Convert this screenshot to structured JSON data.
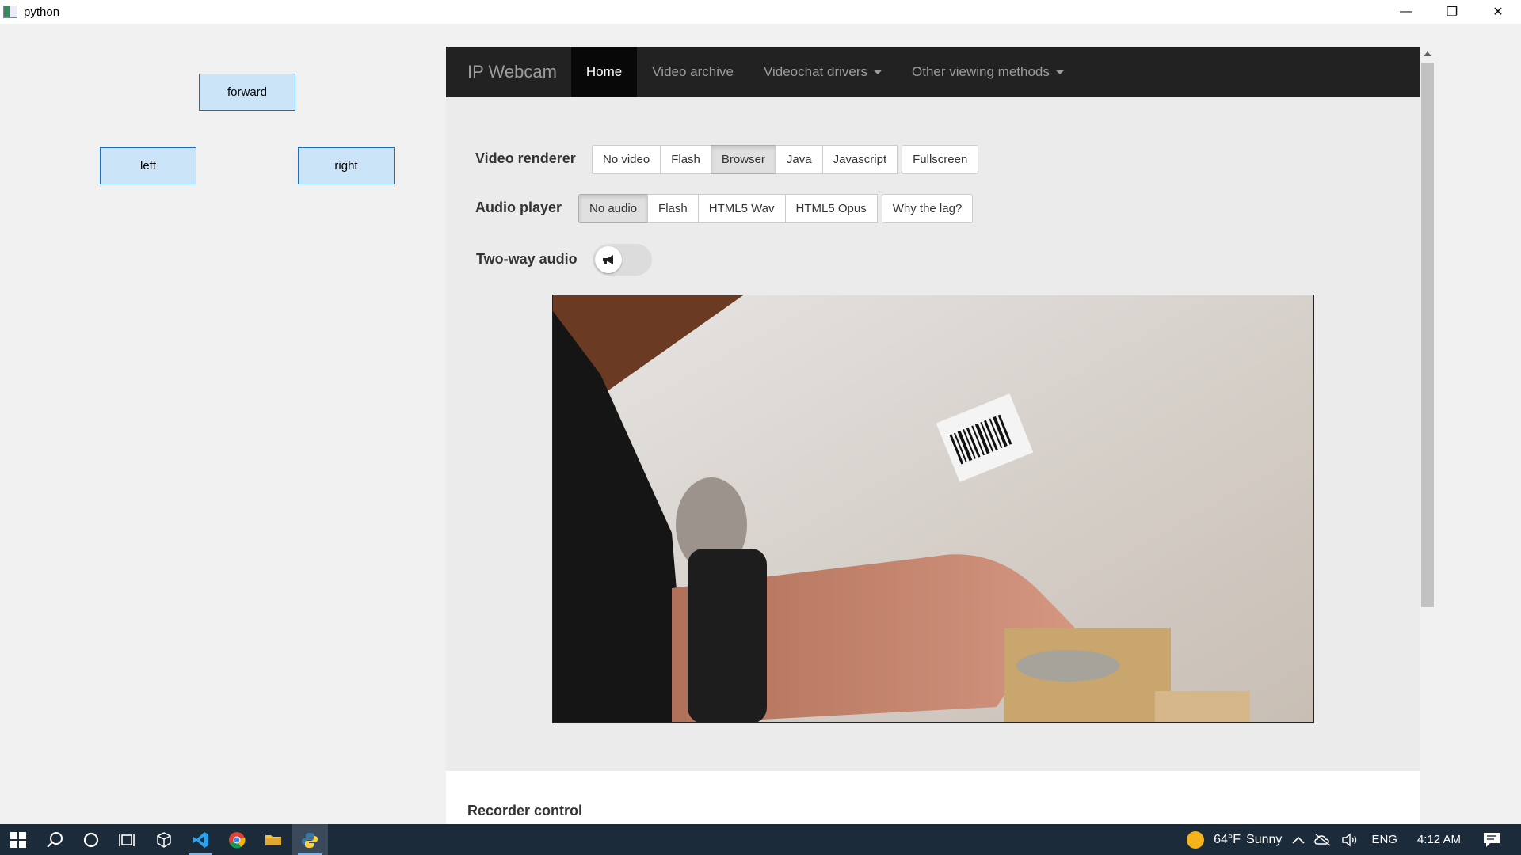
{
  "window": {
    "title": "python",
    "minimize_glyph": "—",
    "restore_glyph": "❐",
    "close_glyph": "✕"
  },
  "controls": {
    "forward": "forward",
    "left": "left",
    "right": "right"
  },
  "webcam": {
    "brand": "IP Webcam",
    "nav": {
      "home": "Home",
      "video_archive": "Video archive",
      "videochat_drivers": "Videochat drivers",
      "other_viewing_methods": "Other viewing methods"
    },
    "video_renderer": {
      "label": "Video renderer",
      "options": [
        "No video",
        "Flash",
        "Browser",
        "Java",
        "Javascript"
      ],
      "selected": "Browser",
      "fullscreen": "Fullscreen"
    },
    "audio_player": {
      "label": "Audio player",
      "options": [
        "No audio",
        "Flash",
        "HTML5 Wav",
        "HTML5 Opus"
      ],
      "selected": "No audio",
      "why_lag": "Why the lag?"
    },
    "two_way_audio": {
      "label": "Two-way audio",
      "enabled": false
    },
    "recorder": {
      "title": "Recorder control"
    }
  },
  "taskbar": {
    "weather_temp": "64°F",
    "weather_text": "Sunny",
    "language": "ENG",
    "time": "4:12 AM"
  },
  "colors": {
    "navbar_bg": "#222222",
    "tk_button_bg": "#cce4f7",
    "tk_button_border": "#1b6fb7",
    "taskbar_bg": "#1c2b3a"
  }
}
